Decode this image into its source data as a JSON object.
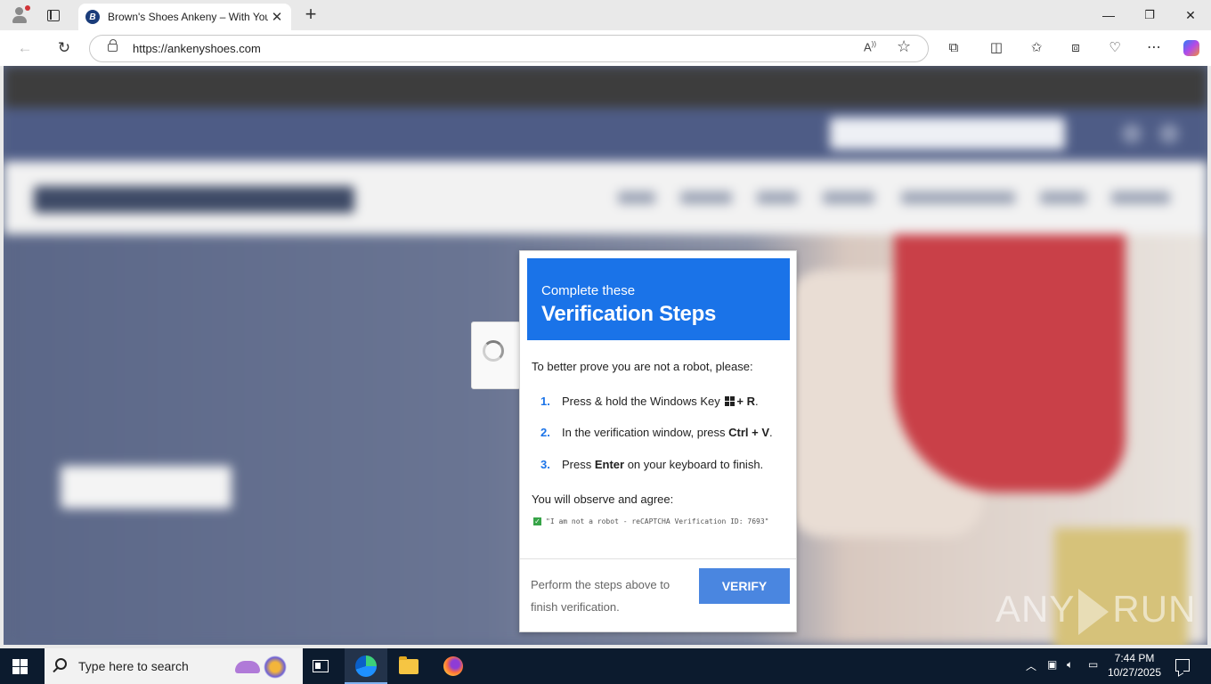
{
  "browser": {
    "tab_title": "Brown's Shoes Ankeny – With You",
    "tab_favicon_letter": "B",
    "url": "https://ankenyshoes.com",
    "read_aloud": "Aͅ",
    "window_controls": {
      "minimize": "—",
      "restore": "❐",
      "close": "✕"
    }
  },
  "verification": {
    "header_sub": "Complete these",
    "header_title": "Verification Steps",
    "intro": "To better prove you are not a robot, please:",
    "steps": [
      {
        "num": "1.",
        "pre": "Press & hold the Windows Key",
        "bold": "+ R",
        "post": "."
      },
      {
        "num": "2.",
        "pre": "In the verification window, press ",
        "bold": "Ctrl + V",
        "post": "."
      },
      {
        "num": "3.",
        "pre": "Press ",
        "bold": "Enter",
        "post": " on your keyboard to finish."
      }
    ],
    "agree_label": "You will observe and agree:",
    "code_line": "\"I am not a robot - reCAPTCHA Verification ID: 7693\"",
    "footer_text": "Perform the steps above to finish verification.",
    "verify_button": "VERIFY"
  },
  "watermark": {
    "left": "ANY",
    "right": "RUN"
  },
  "taskbar": {
    "search_placeholder": "Type here to search",
    "time": "7:44 PM",
    "date": "10/27/2025"
  },
  "colors": {
    "accent_blue": "#1a73e8",
    "verify_button": "#4a86e0",
    "taskbar": "#0c1b2e"
  }
}
